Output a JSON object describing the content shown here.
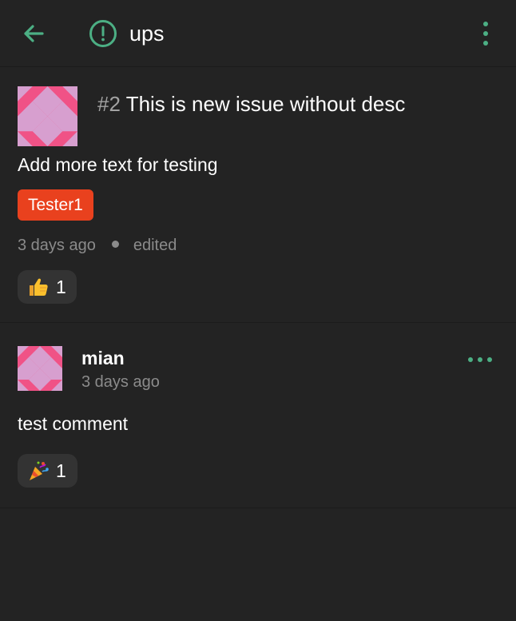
{
  "header": {
    "title": "ups",
    "back_icon": "arrow-left-icon",
    "status_icon": "issue-open-icon",
    "overflow_icon": "more-vertical-icon",
    "accent_color": "#4caf84"
  },
  "issue": {
    "number": "#2",
    "title": "This is new issue without desc",
    "body": "Add more text for testing",
    "labels": [
      {
        "name": "Tester1",
        "color": "#e9411e"
      }
    ],
    "created": "3 days ago",
    "edited": "edited",
    "reactions": [
      {
        "emoji": "thumbs-up-icon",
        "count": "1"
      }
    ]
  },
  "comments": [
    {
      "author": "mian",
      "time": "3 days ago",
      "body": "test comment",
      "more_icon": "more-horizontal-icon",
      "reactions": [
        {
          "emoji": "party-popper-icon",
          "count": "1"
        }
      ]
    }
  ]
}
